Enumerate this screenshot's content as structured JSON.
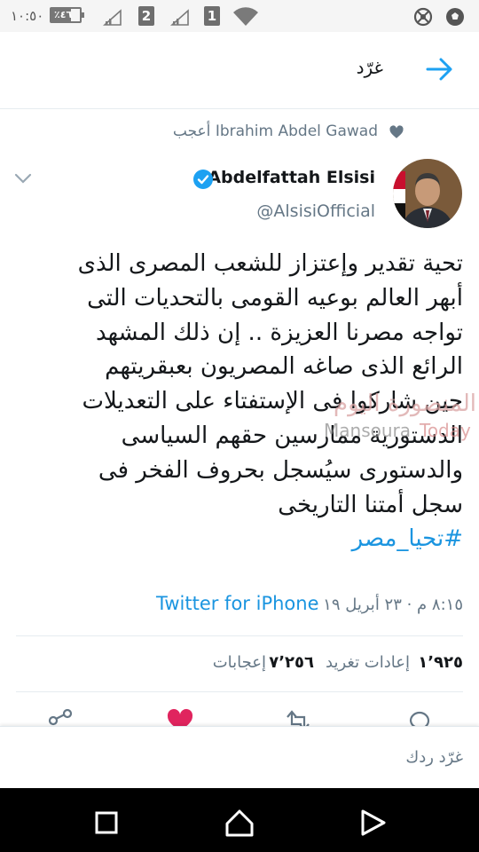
{
  "status_bar": {
    "time": "١٠:٥٠",
    "battery_label": "٪٤٦",
    "sim1": "1",
    "sim2": "2"
  },
  "header": {
    "title": "غرّد"
  },
  "liked_by": {
    "text": "Ibrahim Abdel Gawad أعجب"
  },
  "tweet": {
    "author_name": "Abdelfattah Elsisi",
    "author_handle": "@AlsisiOfficial",
    "text_lines": [
      "تحية تقدير وإعتزاز للشعب المصرى الذى",
      "أبهر العالم بوعيه القومى بالتحديات التى",
      "تواجه مصرنا العزيزة .. إن ذلك المشهد",
      "الرائع الذى صاغه المصريون بعبقريتهم",
      "حين شاركوا فى الإستفتاء على التعديلات",
      "الدستورية ممارسين حقهم السياسى",
      "والدستورى سيُسجل بحروف الفخر فى",
      "سجل أمتنا التاريخى"
    ],
    "hashtag": "#تحيا_مصر",
    "timestamp": "٨:١٥ م · ٢٣ أبريل ١٩ ·",
    "source": "Twitter for iPhone",
    "retweets_count": "١٬٩٢٥",
    "retweets_label": "إعادات تغريد",
    "likes_count": "٧٬٢٥٦",
    "likes_label": "إعجابات"
  },
  "watermark": {
    "arabic": "المنصورة اليوم",
    "english_1": "Mansoura",
    "english_2": "Today"
  },
  "reply_bar": {
    "placeholder": "غرّد ردك"
  },
  "colors": {
    "link_blue": "#1b95e0",
    "text_dark": "#14171a",
    "text_gray": "#657786",
    "like_red": "#e0245e"
  },
  "icons": [
    "back-arrow-icon",
    "heart-icon",
    "chevron-down-icon",
    "verified-badge-icon",
    "reply-icon",
    "retweet-icon",
    "like-icon",
    "share-icon",
    "nav-back-icon",
    "nav-home-icon",
    "nav-recents-icon"
  ]
}
